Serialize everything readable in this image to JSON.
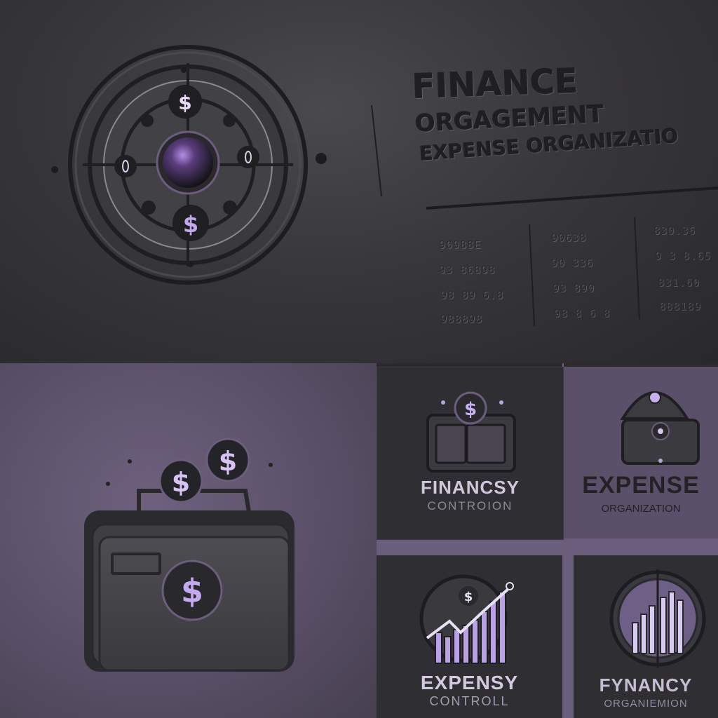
{
  "top_panel": {
    "title_line1": "FINANCE",
    "title_line2": "ORGAGEMENT",
    "title_line3": "EXPENSE ORGANIZATIO",
    "columns": [
      [
        "90988E",
        "93 86898",
        "98 89 6.8",
        "988898"
      ],
      [
        "90638",
        "90 336",
        "93 890",
        "98 8 6 8"
      ],
      [
        "830.36",
        "9 3 8.65",
        "831.60",
        "888189"
      ]
    ],
    "emblem_icon": "coin-target-icon"
  },
  "wallet_panel": {
    "icon": "wallet-coins-icon"
  },
  "card_a": {
    "word": "FINANCSY",
    "sub": "CONTROION",
    "icon": "wallet-coin-icon"
  },
  "card_b": {
    "word": "EXPENSE",
    "sub": "ORGANIZATION",
    "icon": "purse-icon"
  },
  "card_c": {
    "word": "EXPENSY",
    "sub": "CONTROLL",
    "icon": "growth-chart-icon"
  },
  "card_d": {
    "word": "FYNANCY",
    "sub": "ORGANIEMION",
    "icon": "bar-chart-circle-icon"
  },
  "colors": {
    "accent": "#9a7fd0",
    "dark": "#2f2e32",
    "purple_bg": "#5b5069"
  }
}
